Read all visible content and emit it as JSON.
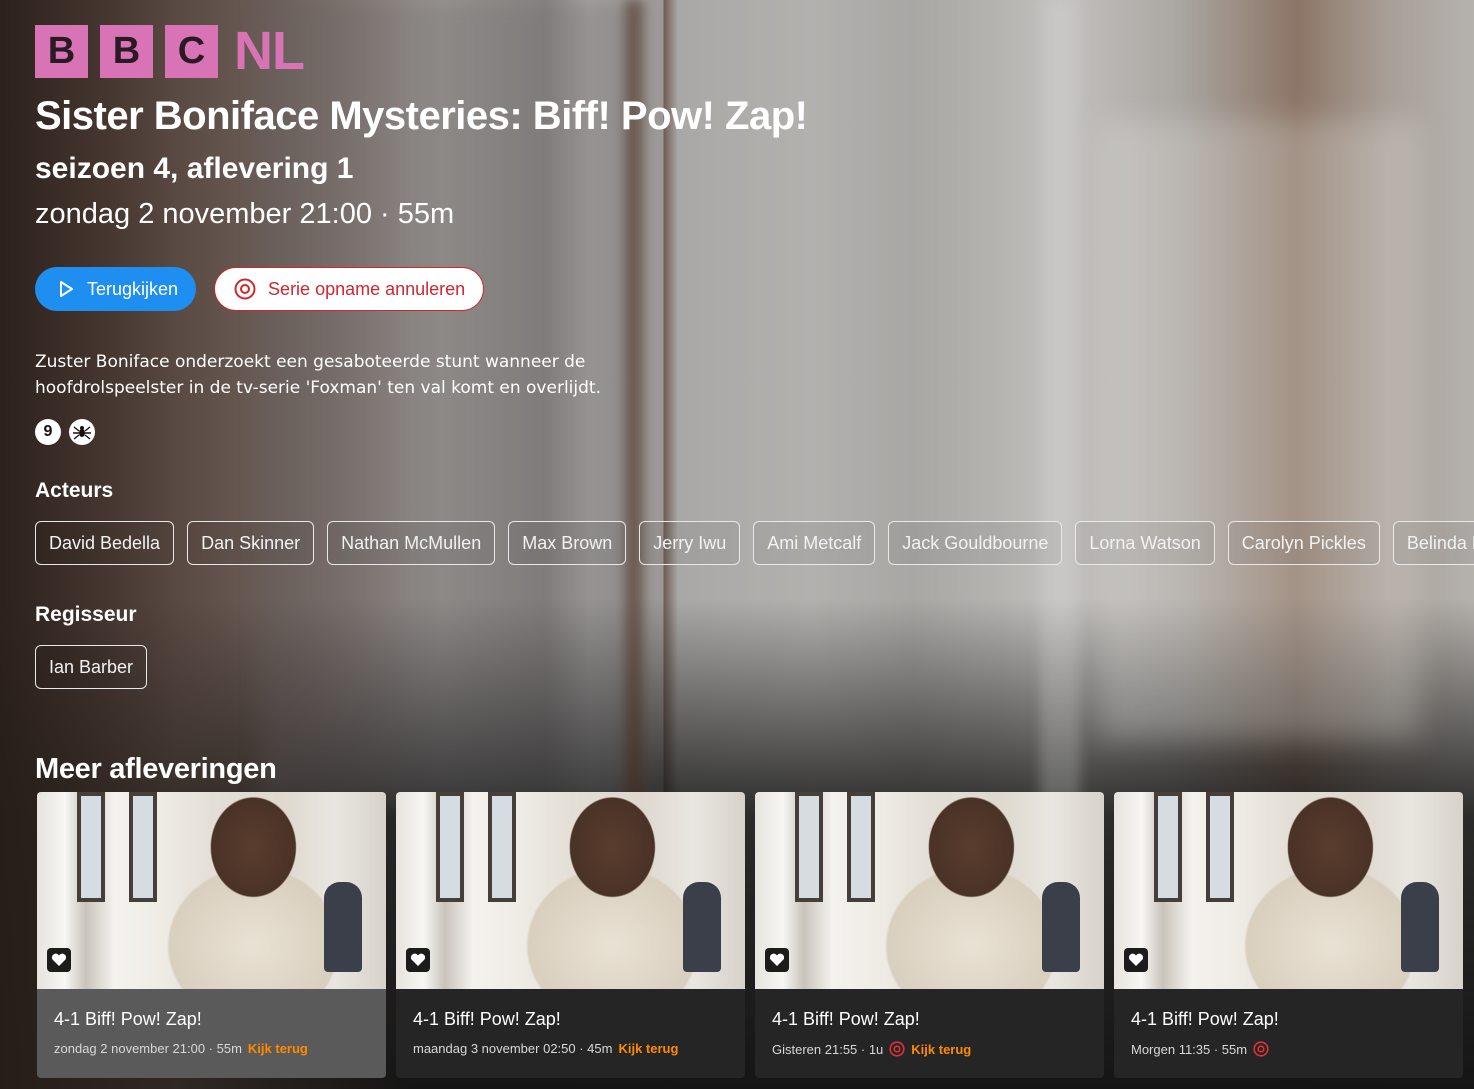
{
  "logo": {
    "letters": [
      "B",
      "B",
      "C"
    ],
    "suffix": "NL",
    "color": "#d873b6"
  },
  "program": {
    "title": "Sister Boniface Mysteries: Biff! Pow! Zap!",
    "subtitle": "seizoen 4, aflevering 1",
    "datetime": "zondag 2 november 21:00 · 55m",
    "description": "Zuster Boniface onderzoekt een gesaboteerde stunt wanneer de hoofdrolspeelster in de tv-serie 'Foxman' ten val komt en overlijdt.",
    "age_rating": "9",
    "content_icon": "spider-icon"
  },
  "buttons": {
    "watch_label": "Terugkijken",
    "cancel_label": "Serie opname annuleren"
  },
  "actors": {
    "heading": "Acteurs",
    "names": [
      "David Bedella",
      "Dan Skinner",
      "Nathan McMullen",
      "Max Brown",
      "Jerry Iwu",
      "Ami Metcalf",
      "Jack Gouldbourne",
      "Lorna Watson",
      "Carolyn Pickles",
      "Belinda La"
    ]
  },
  "director": {
    "heading": "Regisseur",
    "names": [
      "Ian Barber"
    ]
  },
  "more": {
    "heading": "Meer afleveringen",
    "episodes": [
      {
        "title": "4-1 Biff! Pow! Zap!",
        "meta": "zondag 2 november 21:00 · 55m",
        "status": "Kijk terug",
        "record": false
      },
      {
        "title": "4-1 Biff! Pow! Zap!",
        "meta": "maandag 3 november 02:50 · 45m",
        "status": "Kijk terug",
        "record": false
      },
      {
        "title": "4-1 Biff! Pow! Zap!",
        "meta": "Gisteren 21:55 · 1u",
        "status": "Kijk terug",
        "record": true
      },
      {
        "title": "4-1 Biff! Pow! Zap!",
        "meta": "Morgen 11:35 · 55m",
        "status": "",
        "record": true
      }
    ]
  },
  "colors": {
    "accent_blue": "#1e8ef0",
    "record_red": "#d0262e",
    "kijk_terug": "#ff8a00"
  }
}
